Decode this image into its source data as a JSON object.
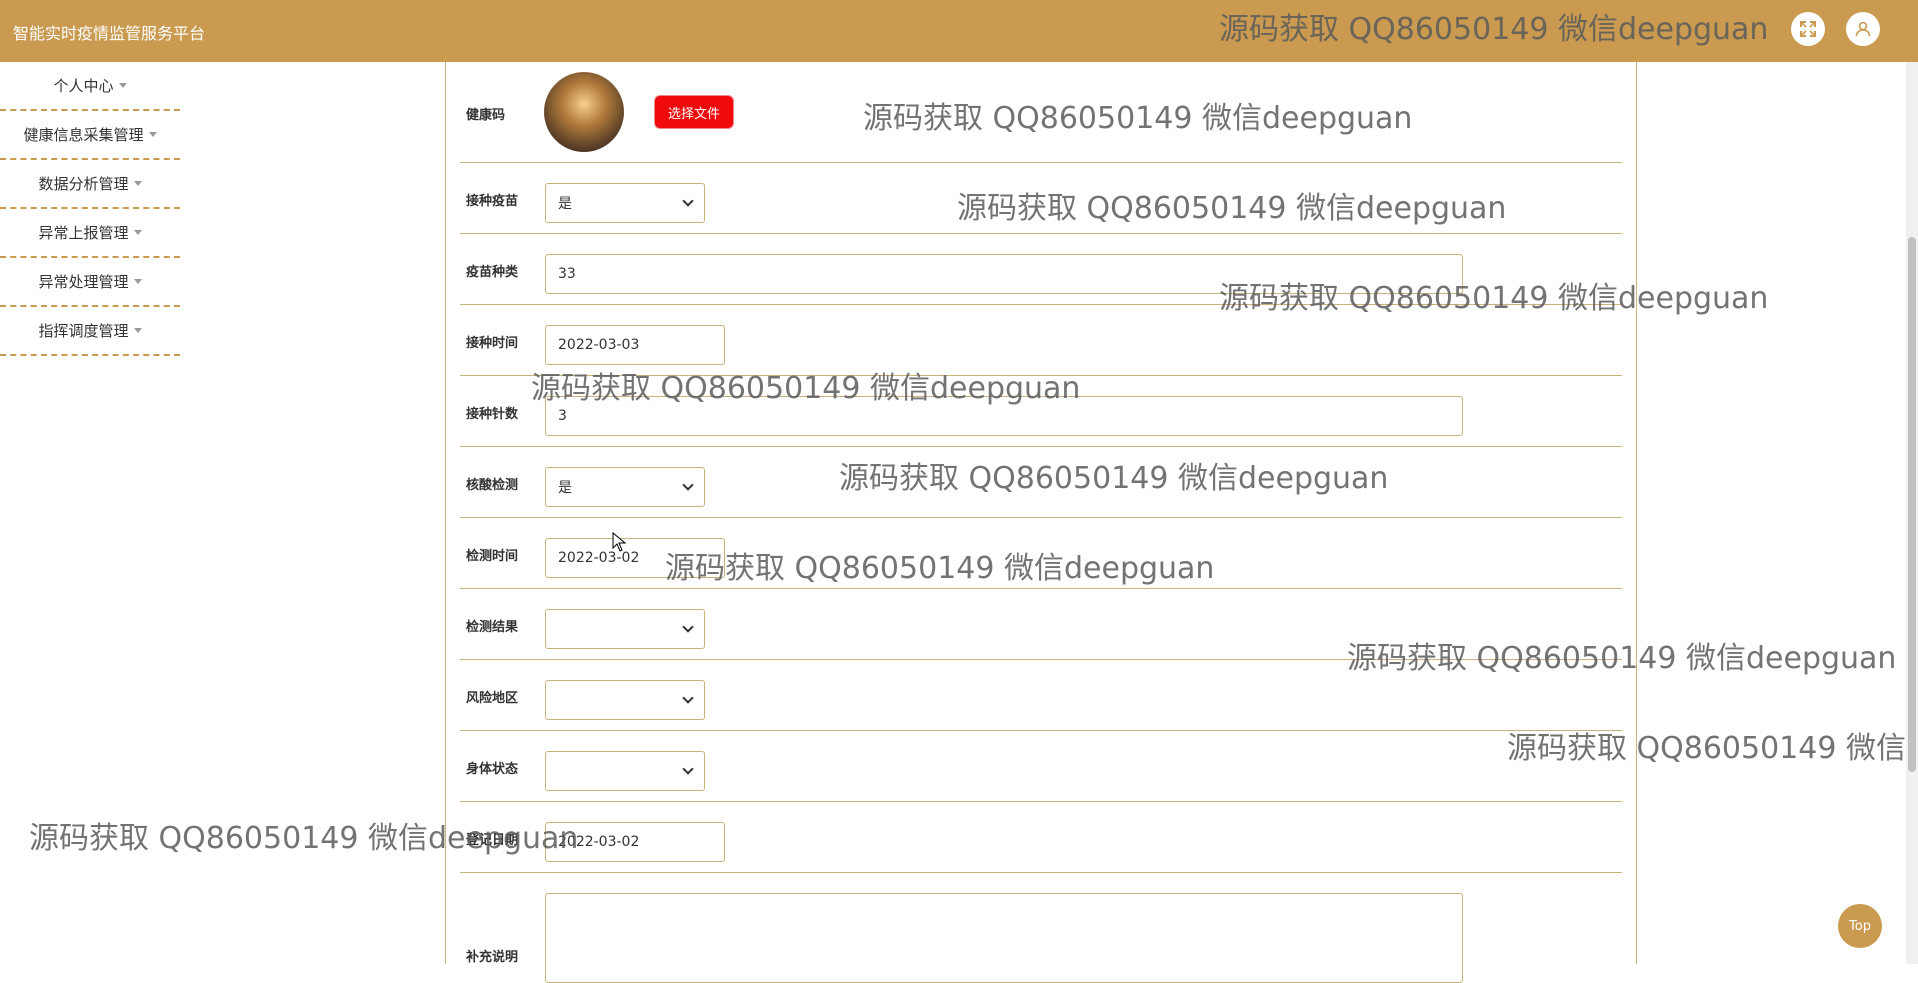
{
  "app": {
    "title": "智能实时疫情监管服务平台"
  },
  "sidebar": {
    "items": [
      {
        "label": "个人中心"
      },
      {
        "label": "健康信息采集管理"
      },
      {
        "label": "数据分析管理"
      },
      {
        "label": "异常上报管理"
      },
      {
        "label": "异常处理管理"
      },
      {
        "label": "指挥调度管理"
      }
    ]
  },
  "form": {
    "health_code": {
      "label": "健康码",
      "button": "选择文件"
    },
    "vaccinated": {
      "label": "接种疫苗",
      "value": "是"
    },
    "vaccine_type": {
      "label": "疫苗种类",
      "value": "33"
    },
    "vaccination_time": {
      "label": "接种时间",
      "value": "2022-03-03"
    },
    "dose_count": {
      "label": "接种针数",
      "value": "3"
    },
    "nucleic_test": {
      "label": "核酸检测",
      "value": "是"
    },
    "test_time": {
      "label": "检测时间",
      "value": "2022-03-02"
    },
    "test_result": {
      "label": "检测结果",
      "value": ""
    },
    "risk_area": {
      "label": "风险地区",
      "value": ""
    },
    "body_status": {
      "label": "身体状态",
      "value": ""
    },
    "register_date": {
      "label": "登记日期",
      "value": "2022-03-02"
    },
    "notes": {
      "label": "补充说明",
      "value": ""
    }
  },
  "watermark": {
    "text": "源码获取 QQ86050149 微信deepguan"
  },
  "top_button": {
    "label": "Top"
  },
  "colors": {
    "header": "#c99a4f",
    "accent_red": "#ef0b0b",
    "border": "#c9b37a"
  }
}
